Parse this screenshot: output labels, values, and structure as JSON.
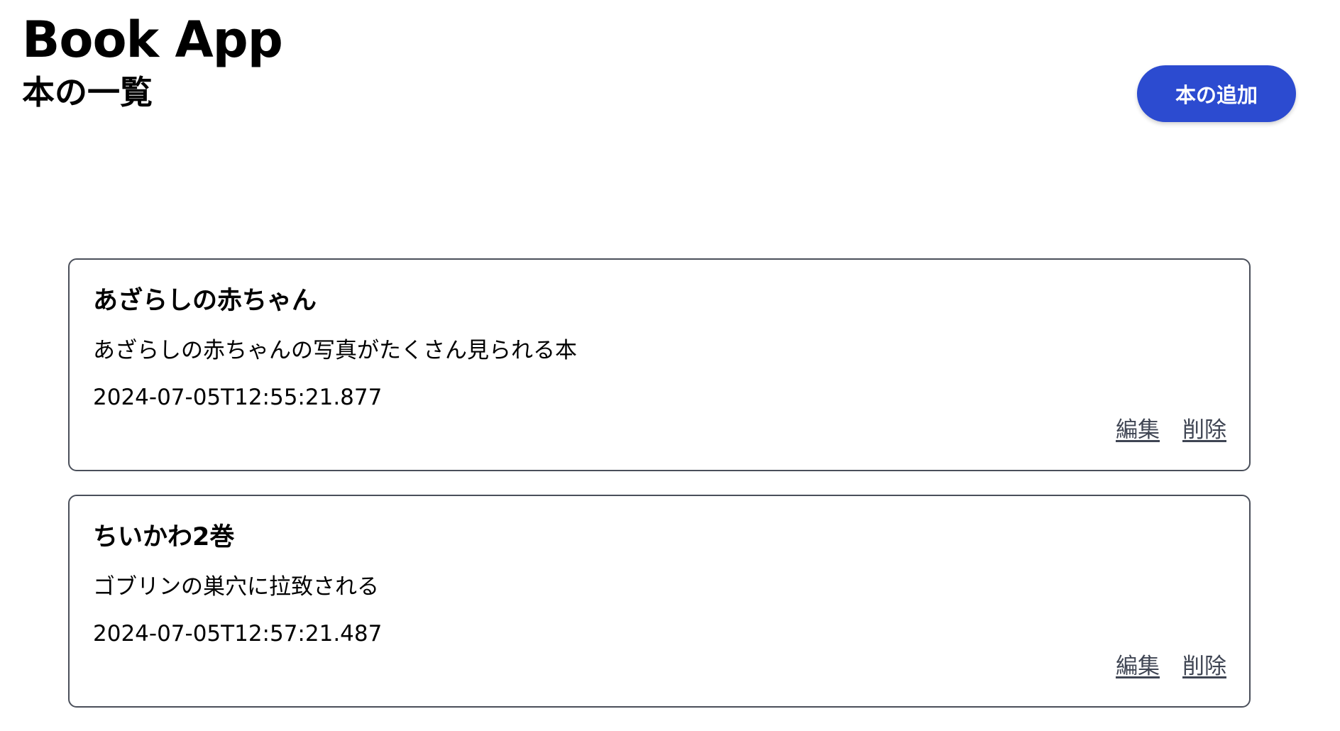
{
  "app": {
    "title": "Book App"
  },
  "header": {
    "page_title": "本の一覧",
    "add_button_label": "本の追加"
  },
  "colors": {
    "accent": "#2c4bd0",
    "card_border": "#4a4f5a",
    "link": "#3f4553"
  },
  "books": [
    {
      "title": "あざらしの赤ちゃん",
      "description": "あざらしの赤ちゃんの写真がたくさん見られる本",
      "date": "2024-07-05T12:55:21.877",
      "edit_label": "編集",
      "delete_label": "削除"
    },
    {
      "title": "ちいかわ2巻",
      "description": "ゴブリンの巣穴に拉致される",
      "date": "2024-07-05T12:57:21.487",
      "edit_label": "編集",
      "delete_label": "削除"
    }
  ]
}
